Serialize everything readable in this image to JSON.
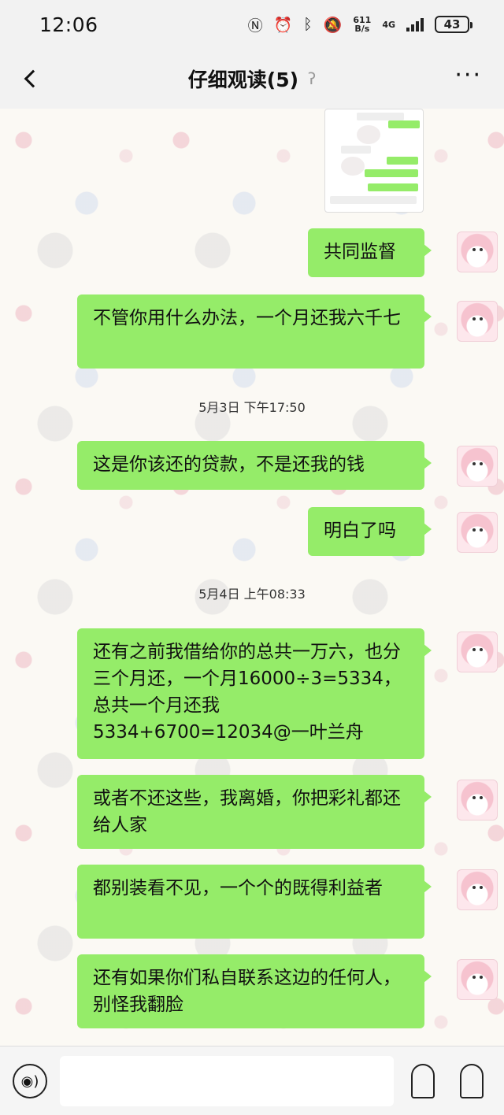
{
  "status_bar": {
    "time": "12:06",
    "icons": [
      "nfc-icon",
      "alarm-icon",
      "bluetooth-icon",
      "mute-icon"
    ],
    "net_speed_value": "611",
    "net_speed_unit": "B/s",
    "network": "4G",
    "battery": "43"
  },
  "header": {
    "title": "仔细观读(5)",
    "back_icon": "chevron-left-icon",
    "ear_icon": "ear-icon",
    "more_label": "···"
  },
  "messages": [
    {
      "text": "共同监督"
    },
    {
      "text": "不管你用什么办法，一个月还我六千七"
    },
    {
      "time": "5月3日 下午17:50"
    },
    {
      "text": "这是你该还的贷款，不是还我的钱"
    },
    {
      "text": "明白了吗"
    },
    {
      "time": "5月4日 上午08:33"
    },
    {
      "text": "还有之前我借给你的总共一万六，也分三个月还，一个月16000÷3=5334，总共一个月还我5334+6700=12034@一叶兰舟"
    },
    {
      "text": "或者不还这些，我离婚，你把彩礼都还给人家"
    },
    {
      "text": "都别装看不见，一个个的既得利益者"
    },
    {
      "text": "还有如果你们私自联系这边的任何人，别怪我翻脸"
    }
  ],
  "input_bar": {
    "placeholder": "",
    "voice_icon": "voice-icon",
    "emoji_icon": "emoji-icon",
    "plus_icon": "plus-icon"
  },
  "colors": {
    "bubble": "#95ec69",
    "bar_bg": "#f2f2f2"
  }
}
